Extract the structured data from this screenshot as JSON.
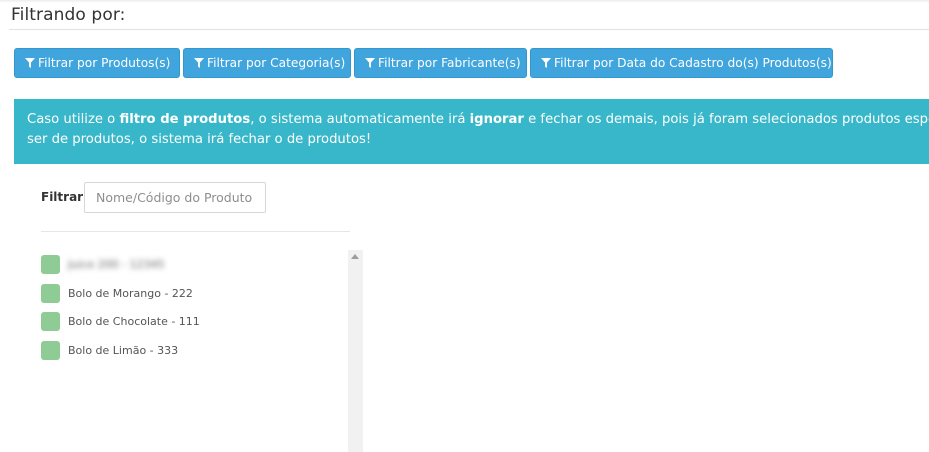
{
  "page": {
    "title": "Filtrando por:"
  },
  "filter_buttons": [
    {
      "label": "Filtrar por Produtos(s)",
      "icon": "filter-icon"
    },
    {
      "label": "Filtrar por Categoria(s)",
      "icon": "filter-icon"
    },
    {
      "label": "Filtrar por Fabricante(s)",
      "icon": "filter-icon"
    },
    {
      "label": "Filtrar por Data do Cadastro do(s) Produtos(s)",
      "icon": "filter-icon"
    }
  ],
  "alert": {
    "line1_part1": "Caso utilize o ",
    "line1_bold1": "filtro de produtos",
    "line1_part2": ", o sistema automaticamente irá ",
    "line1_bold2": "ignorar",
    "line1_part3": " e fechar os demais, pois já foram selecionados produtos específicos, c",
    "line2": "ser de produtos, o sistema irá fechar o de produtos!"
  },
  "search": {
    "label": "Filtrar:",
    "placeholder": "Nome/Código do Produto",
    "value": ""
  },
  "products": [
    {
      "label": "Juice 200 - 12345",
      "blurred": true
    },
    {
      "label": "Bolo de Morango - 222",
      "blurred": false
    },
    {
      "label": "Bolo de Chocolate - 111",
      "blurred": false
    },
    {
      "label": "Bolo de Limão - 333",
      "blurred": false
    }
  ],
  "colors": {
    "button_bg": "#3fa5dc",
    "alert_bg": "#37b7c9",
    "checkbox": "#8fcb95"
  }
}
